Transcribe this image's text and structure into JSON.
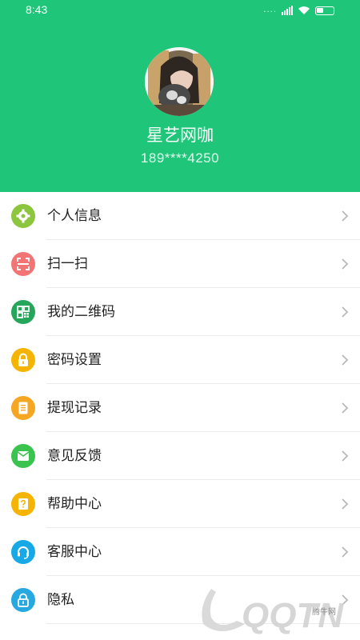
{
  "status_bar": {
    "time": "8:43",
    "signal_dots": "...."
  },
  "profile": {
    "name": "星艺网咖",
    "phone": "189****4250"
  },
  "menu": [
    {
      "label": "个人信息",
      "icon": "gear-icon",
      "color": "#8cc63e"
    },
    {
      "label": "扫一扫",
      "icon": "scan-icon",
      "color": "#f27474"
    },
    {
      "label": "我的二维码",
      "icon": "qrcode-icon",
      "color": "#26a65b"
    },
    {
      "label": "密码设置",
      "icon": "lock-icon",
      "color": "#f4b400"
    },
    {
      "label": "提现记录",
      "icon": "document-icon",
      "color": "#f5a623"
    },
    {
      "label": "意见反馈",
      "icon": "feedback-icon",
      "color": "#3ac34d"
    },
    {
      "label": "帮助中心",
      "icon": "help-icon",
      "color": "#f4b400"
    },
    {
      "label": "客服中心",
      "icon": "headset-icon",
      "color": "#16a9e5"
    },
    {
      "label": "隐私",
      "icon": "privacy-lock-icon",
      "color": "#27a8e0"
    }
  ],
  "watermark": {
    "text": "QQTN",
    "site": "腾牛网"
  },
  "colors": {
    "header": "#1fc67a",
    "separator": "#ebebeb",
    "chevron": "#b5b5b5"
  }
}
